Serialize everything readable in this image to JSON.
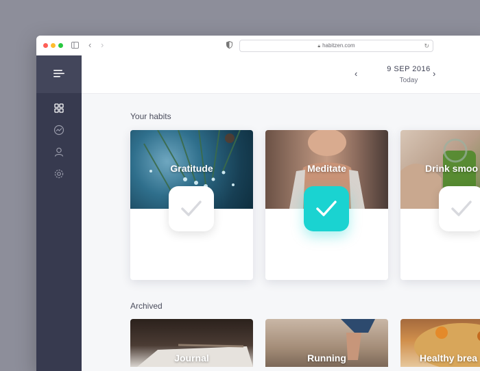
{
  "browser": {
    "url": "habitzen.com"
  },
  "header": {
    "date": "9 SEP 2016",
    "date_sub": "Today"
  },
  "sections": {
    "habits_title": "Your habits",
    "archived_title": "Archived"
  },
  "habits": [
    {
      "name": "Gratitude",
      "completed": false
    },
    {
      "name": "Meditate",
      "completed": true
    },
    {
      "name": "Drink smoo",
      "completed": false
    }
  ],
  "archived": [
    {
      "name": "Journal"
    },
    {
      "name": "Running"
    },
    {
      "name": "Healthy brea"
    }
  ],
  "sidebar": {
    "items": [
      "menu-icon",
      "dashboard-icon",
      "stats-icon",
      "profile-icon",
      "settings-icon"
    ]
  },
  "colors": {
    "accent": "#1ad3d1",
    "sidebar": "#373a4f",
    "background": "#f6f7f9"
  }
}
